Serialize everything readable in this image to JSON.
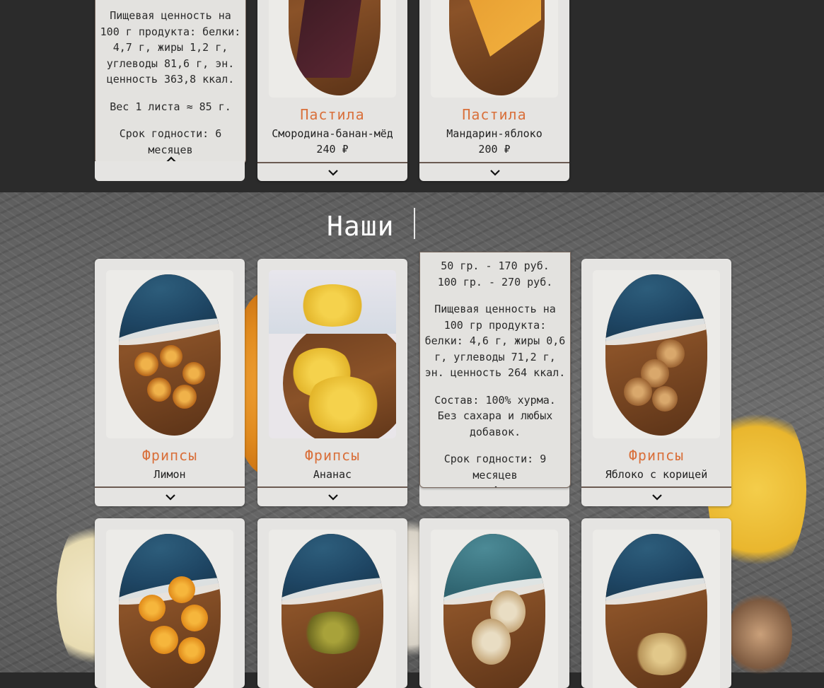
{
  "section_title": "Наши",
  "top_cards": [
    {
      "expanded": true,
      "details": [
        "Пищевая ценность на 100 г продукта: белки: 4,7 г, жиры 1,2 г, углеводы 81,6 г, эн. ценность 363,8 ккал.",
        "Вес 1 листа ≈ 85 г.",
        "Срок годности: 6 месяцев"
      ]
    },
    {
      "name": "Пастила",
      "flavor": "Смородина-банан-мёд",
      "price": "240 ₽"
    },
    {
      "name": "Пастила",
      "flavor": "Мандарин-яблоко",
      "price": "200 ₽"
    }
  ],
  "middle_cards": [
    {
      "name": "Фрипсы",
      "flavor": "Лимон"
    },
    {
      "name": "Фрипсы",
      "flavor": "Ананас"
    },
    {
      "expanded": true,
      "details": [
        "50 гр. - 170 руб. 100 гр. - 270 руб.",
        "Пищевая ценность на 100 гр продукта: белки: 4,6 г, жиры 0,6 г, углеводы 71,2 г, эн. ценность 264 ккал.",
        "Состав: 100% хурма. Без сахара и любых добавок.",
        "Срок годности: 9 месяцев"
      ]
    },
    {
      "name": "Фрипсы",
      "flavor": "Яблоко с корицей"
    }
  ],
  "icons": {
    "expand": "chevron-down-icon",
    "collapse": "chevron-up-icon"
  },
  "colors": {
    "accent": "#d9703b",
    "card_bg": "#e5e4e2",
    "top_bg": "#2b2b2b"
  }
}
